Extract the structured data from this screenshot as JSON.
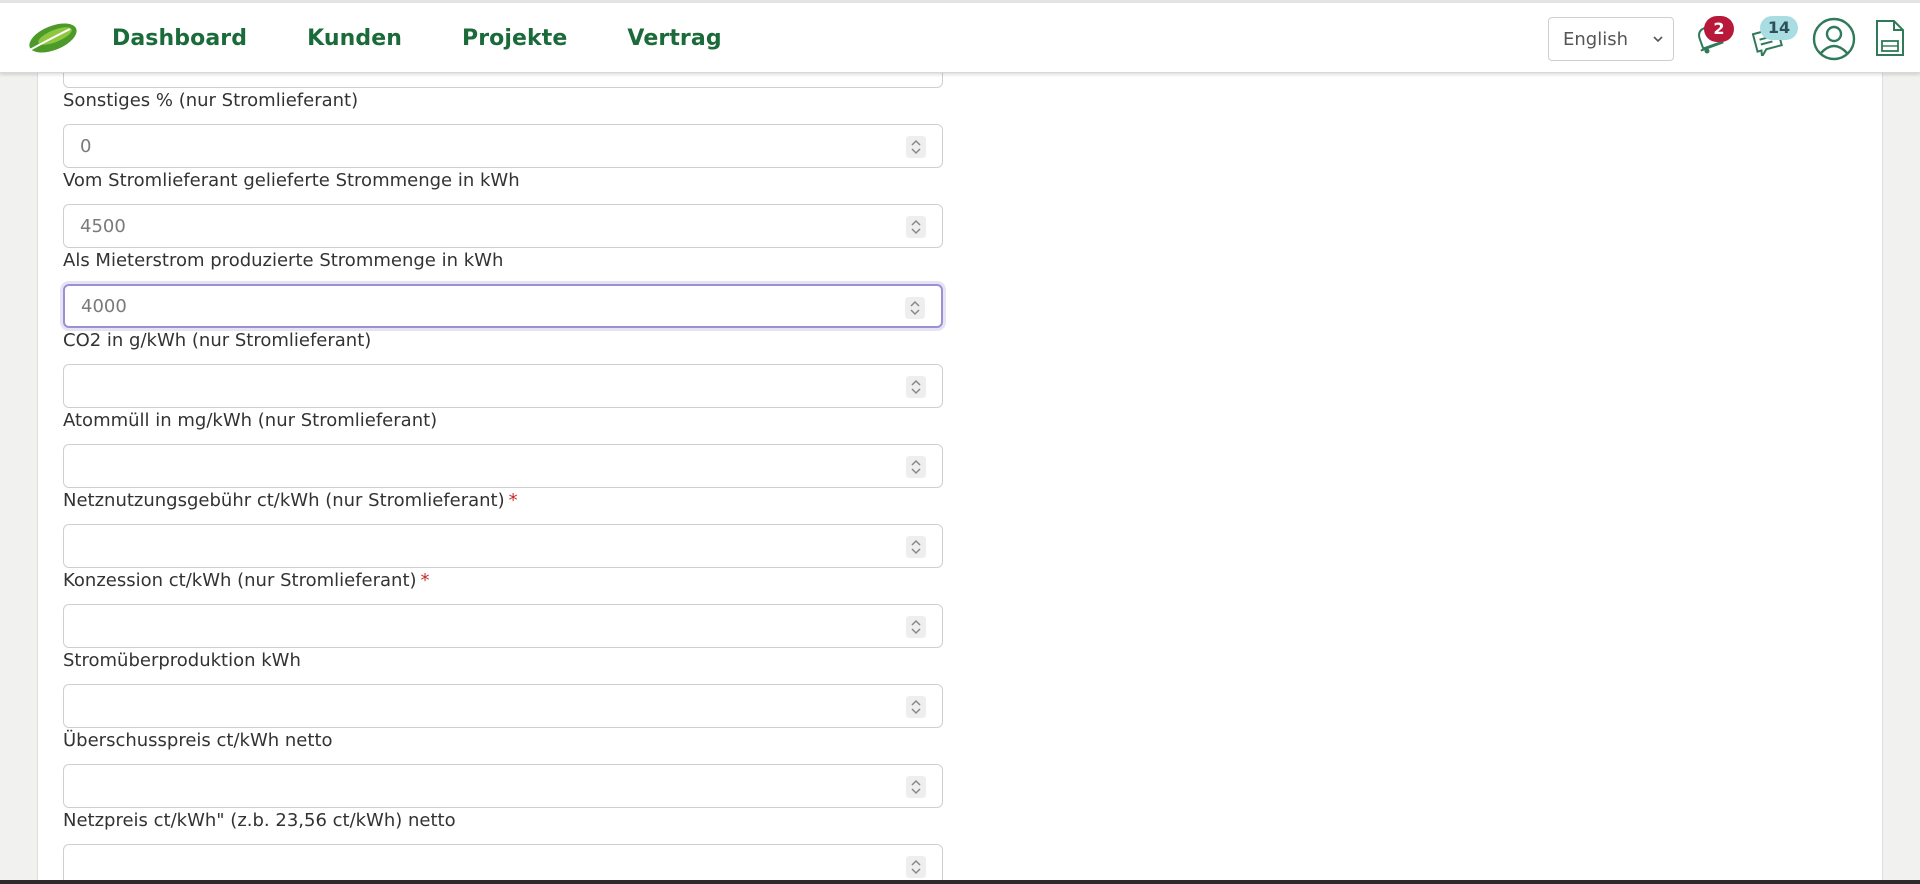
{
  "header": {
    "nav": [
      {
        "label": "Dashboard"
      },
      {
        "label": "Kunden"
      },
      {
        "label": "Projekte"
      },
      {
        "label": "Vertrag"
      }
    ],
    "language": {
      "selected": "English"
    },
    "notifications": {
      "count": "2"
    },
    "messages": {
      "count": "14"
    }
  },
  "form": {
    "fields": [
      {
        "label": "Sonstiges % (nur Stromlieferant)",
        "value": "0",
        "required": false
      },
      {
        "label": "Vom Stromlieferant gelieferte Strommenge in kWh",
        "value": "4500",
        "required": false
      },
      {
        "label": "Als Mieterstrom produzierte Strommenge in kWh",
        "value": "4000",
        "required": false,
        "focused": true
      },
      {
        "label": "CO2 in g/kWh (nur Stromlieferant)",
        "value": "",
        "required": false
      },
      {
        "label": "Atommüll in mg/kWh (nur Stromlieferant)",
        "value": "",
        "required": false
      },
      {
        "label": "Netznutzungsgebühr ct/kWh (nur Stromlieferant)",
        "value": "",
        "required": true
      },
      {
        "label": "Konzession ct/kWh (nur Stromlieferant)",
        "value": "",
        "required": true
      },
      {
        "label": "Stromüberproduktion kWh",
        "value": "",
        "required": false
      },
      {
        "label": "Überschusspreis ct/kWh netto",
        "value": "",
        "required": false
      },
      {
        "label": "Netzpreis ct/kWh\" (z.b. 23,56 ct/kWh) netto",
        "value": "",
        "required": false
      }
    ],
    "required_marker": "*"
  },
  "colors": {
    "nav_green": "#1b6b3a",
    "badge_red": "#b8193a",
    "badge_teal": "#a9dde2",
    "focus_border": "#9c8fd4",
    "required_red": "#c62828"
  }
}
